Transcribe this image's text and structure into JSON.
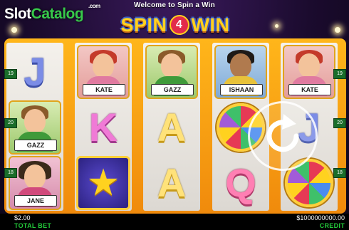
{
  "header": {
    "title": "Welcome to Spin a Win"
  },
  "watermark": {
    "part1": "Slot",
    "part2": "Catalog",
    "suffix": ".com"
  },
  "logo": {
    "left": "SPIN",
    "middle": "4",
    "right": "WIN"
  },
  "reels": [
    [
      {
        "type": "letter",
        "value": "J"
      },
      {
        "type": "character",
        "name": "GAZZ"
      },
      {
        "type": "character",
        "name": "JANE"
      }
    ],
    [
      {
        "type": "character",
        "name": "KATE"
      },
      {
        "type": "letter",
        "value": "K"
      },
      {
        "type": "star"
      }
    ],
    [
      {
        "type": "character",
        "name": "GAZZ"
      },
      {
        "type": "letter",
        "value": "A"
      },
      {
        "type": "letter",
        "value": "A"
      }
    ],
    [
      {
        "type": "character",
        "name": "ISHAAN"
      },
      {
        "type": "wheel"
      },
      {
        "type": "letter",
        "value": "Q"
      }
    ],
    [
      {
        "type": "character",
        "name": "KATE"
      },
      {
        "type": "letter",
        "value": "J"
      },
      {
        "type": "wheel"
      }
    ]
  ],
  "paylines": {
    "left": [
      "19",
      "20",
      "18"
    ],
    "right": [
      "19",
      "20",
      "18"
    ]
  },
  "footer": {
    "total_bet_value": "$2.00",
    "total_bet_label": "TOTAL BET",
    "credit_value": "$1000000000.00",
    "credit_label": "CREDIT"
  },
  "icons": {
    "spin": "refresh-arrow-icon"
  }
}
